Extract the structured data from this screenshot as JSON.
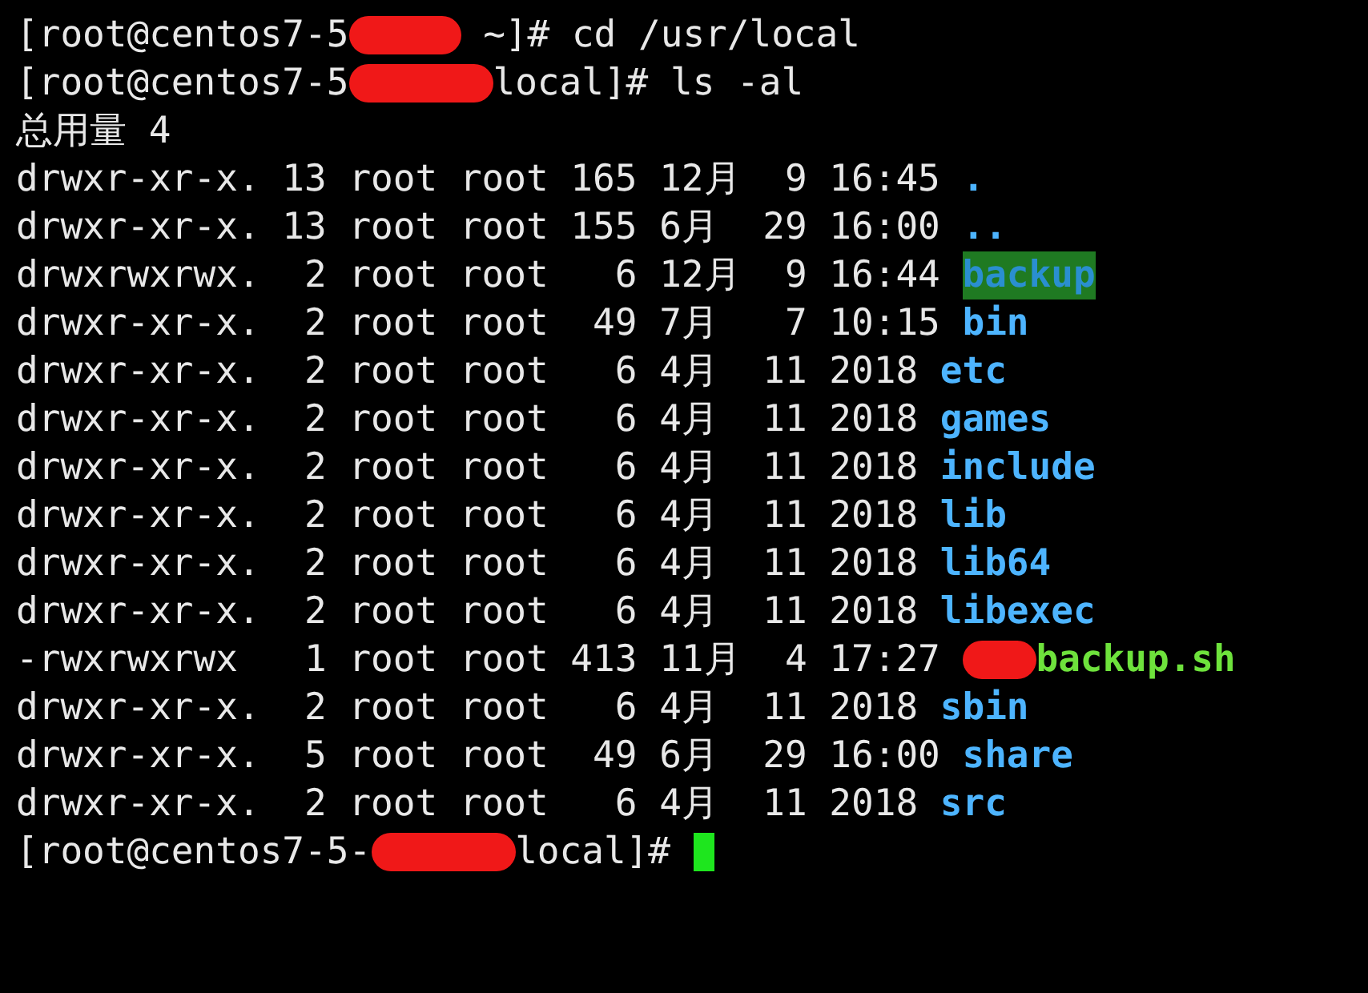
{
  "terminal": {
    "lines": [
      {
        "kind": "prompt",
        "before": "[root@centos7-5",
        "after": " ~]# cd /usr/local"
      },
      {
        "kind": "prompt",
        "before": "[root@centos7-5",
        "after": "local]# ls -al"
      },
      {
        "kind": "text",
        "text": "总用量 4"
      },
      {
        "kind": "entry",
        "info": "drwxr-xr-x. 13 root root 165 12月  9 16:45",
        "name": ".",
        "color": "#4db4ff",
        "highlighted": false,
        "redacted": false
      },
      {
        "kind": "entry",
        "info": "drwxr-xr-x. 13 root root 155 6月  29 16:00",
        "name": "..",
        "color": "#4db4ff",
        "highlighted": false,
        "redacted": false
      },
      {
        "kind": "entry",
        "info": "drwxrwxrwx.  2 root root   6 12月  9 16:44",
        "name": "backup",
        "highlighted": true,
        "redacted": false
      },
      {
        "kind": "entry",
        "info": "drwxr-xr-x.  2 root root  49 7月   7 10:15",
        "name": "bin",
        "color": "#4db4ff",
        "highlighted": false,
        "redacted": false
      },
      {
        "kind": "entry",
        "info": "drwxr-xr-x.  2 root root   6 4月  11 2018",
        "name": "etc",
        "color": "#4db4ff",
        "highlighted": false,
        "redacted": false
      },
      {
        "kind": "entry",
        "info": "drwxr-xr-x.  2 root root   6 4月  11 2018",
        "name": "games",
        "color": "#4db4ff",
        "highlighted": false,
        "redacted": false
      },
      {
        "kind": "entry",
        "info": "drwxr-xr-x.  2 root root   6 4月  11 2018",
        "name": "include",
        "color": "#4db4ff",
        "highlighted": false,
        "redacted": false
      },
      {
        "kind": "entry",
        "info": "drwxr-xr-x.  2 root root   6 4月  11 2018",
        "name": "lib",
        "color": "#4db4ff",
        "highlighted": false,
        "redacted": false
      },
      {
        "kind": "entry",
        "info": "drwxr-xr-x.  2 root root   6 4月  11 2018",
        "name": "lib64",
        "color": "#4db4ff",
        "highlighted": false,
        "redacted": false
      },
      {
        "kind": "entry",
        "info": "drwxr-xr-x.  2 root root   6 4月  11 2018",
        "name": "libexec",
        "color": "#4db4ff",
        "highlighted": false,
        "redacted": false
      },
      {
        "kind": "entry",
        "info": "-rwxrwxrwx   1 root root 413 11月  4 17:27",
        "name": "backup.sh",
        "color": "#6ee23c",
        "highlighted": false,
        "redacted": true
      },
      {
        "kind": "entry",
        "info": "drwxr-xr-x.  2 root root   6 4月  11 2018",
        "name": "sbin",
        "color": "#4db4ff",
        "highlighted": false,
        "redacted": false
      },
      {
        "kind": "entry",
        "info": "drwxr-xr-x.  5 root root  49 6月  29 16:00",
        "name": "share",
        "color": "#4db4ff",
        "highlighted": false,
        "redacted": false
      },
      {
        "kind": "entry",
        "info": "drwxr-xr-x.  2 root root   6 4月  11 2018",
        "name": "src",
        "color": "#4db4ff",
        "highlighted": false,
        "redacted": false
      },
      {
        "kind": "input",
        "before": "[root@centos7-5-",
        "after": "local]#"
      }
    ]
  }
}
